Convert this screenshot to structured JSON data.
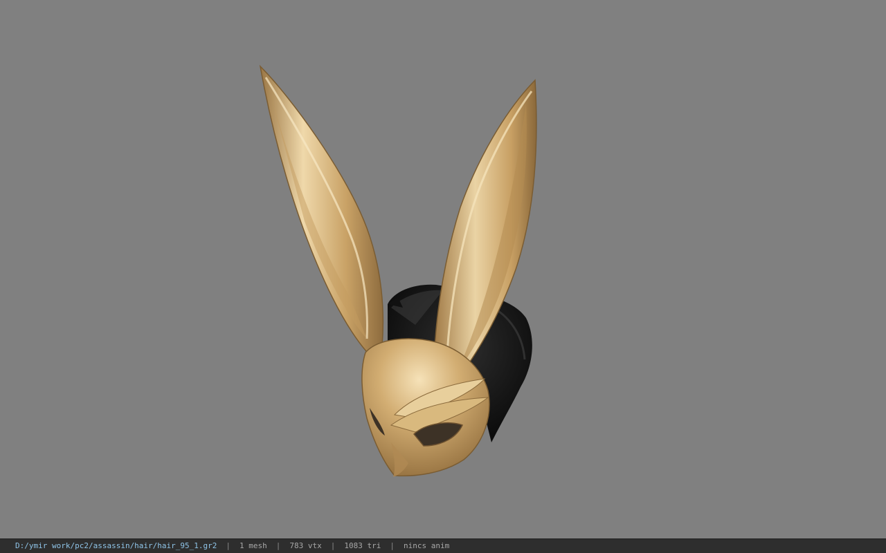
{
  "viewport": {
    "background_color": "#808080",
    "model": "rabbit-ear-mask-with-hair",
    "model_colors": {
      "gold": "#c9a266",
      "gold_highlight": "#f2ddb0",
      "gold_shadow": "#8a6a3c",
      "hair": "#1a1a1a"
    }
  },
  "status_bar": {
    "file_path": "D:/ymir work/pc2/assassin/hair/hair_95_1.gr2",
    "separator": "|",
    "mesh_count": "1 mesh",
    "vertex_count": "783 vtx",
    "triangle_count": "1083 tri",
    "anim_status": "nincs anim"
  }
}
